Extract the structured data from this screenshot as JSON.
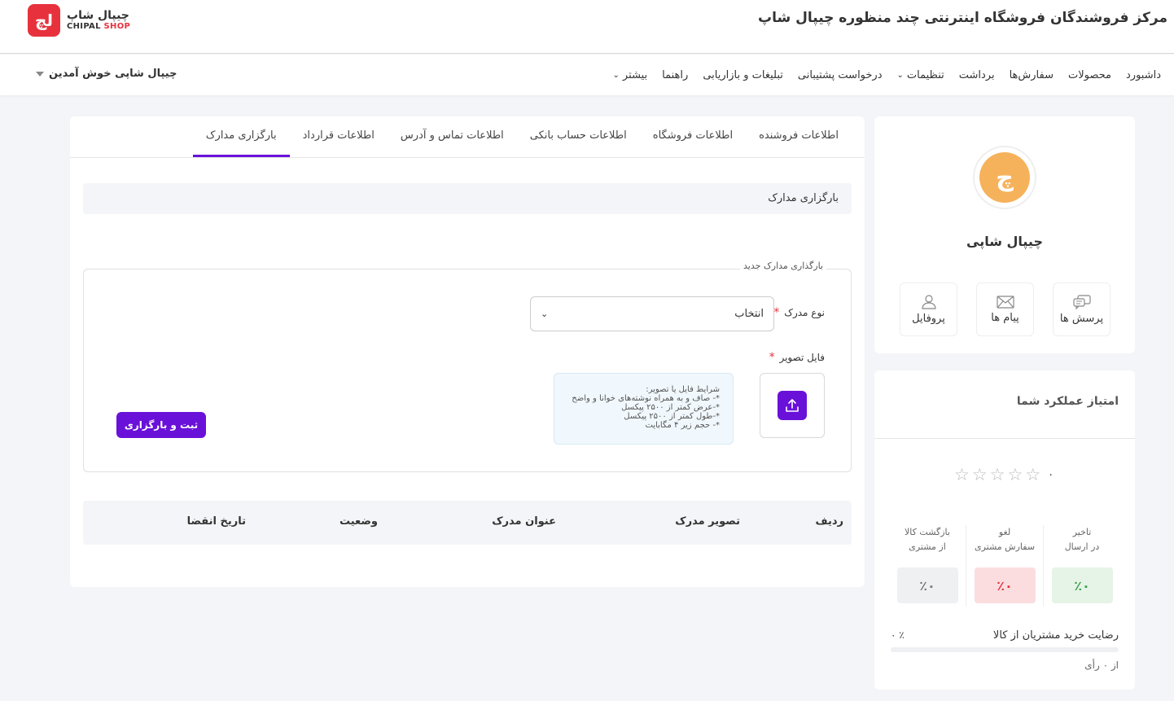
{
  "header": {
    "site_title": "مرکز فروشندگان فروشگاه اینترنتی چند منظوره چیپال شاپ",
    "logo_mark": "لچ",
    "logo_fa": "چیپال شاپ",
    "logo_en_prefix": "CHIPAL ",
    "logo_en_suffix": "SHOP"
  },
  "nav": {
    "items": [
      {
        "label": "داشبورد"
      },
      {
        "label": "محصولات"
      },
      {
        "label": "سفارش‌ها"
      },
      {
        "label": "برداشت"
      },
      {
        "label": "تنظیمات"
      },
      {
        "label": "درخواست پشتیبانی"
      },
      {
        "label": "تبلیغات و بازاریابی"
      },
      {
        "label": "راهنما"
      },
      {
        "label": "بیشتر"
      }
    ],
    "user_welcome": "چیپال شاپی خوش آمدین"
  },
  "tabs": [
    {
      "label": "اطلاعات فروشنده"
    },
    {
      "label": "اطلاعات فروشگاه"
    },
    {
      "label": "اطلاعات حساب بانکی"
    },
    {
      "label": "اطلاعات تماس و آدرس"
    },
    {
      "label": "اطلاعات قرارداد"
    },
    {
      "label": "بارگزاری مدارک"
    }
  ],
  "section_title": "بارگزاری مدارک",
  "form": {
    "legend": "بارگذاری مدارک جدید",
    "doc_type_label": "نوع مدرک",
    "doc_type_value": "انتخاب",
    "file_label": "فایل تصویر",
    "conditions": [
      "شرایط فایل یا تصویر:",
      "*- صاف و به همراه نوشته‌های خوانا و واضح",
      "*-عرض کمتر از ۲۵۰۰ پیکسل",
      "*-طول کمتر از ۲۵۰۰ پیکسل",
      "*- حجم زیر ۴ مگابایت"
    ],
    "submit_label": "ثبت و بارگزاری"
  },
  "table": {
    "headers": [
      "ردیف",
      "تصویر مدرک",
      "عنوان مدرک",
      "وضعیت",
      "تاریخ انقضا"
    ]
  },
  "profile": {
    "avatar_letter": "چ",
    "shop_name": "چیپال شاپی",
    "quick": [
      {
        "label": "پرسش ها",
        "icon": "chat-bubbles-icon"
      },
      {
        "label": "پیام ها",
        "icon": "envelope-icon"
      },
      {
        "label": "پروفایل",
        "icon": "user-icon"
      }
    ]
  },
  "performance": {
    "title": "امتیاز عملکرد شما",
    "rating": "۰",
    "stars_filled": 0,
    "stars_total": 5,
    "metrics": [
      {
        "label_line1": "تاخیر",
        "label_line2": "در ارسال",
        "value": "٪۰",
        "color": "#3a9b4a"
      },
      {
        "label_line1": "لغو",
        "label_line2": "سفارش مشتری",
        "value": "٪۰",
        "color": "#e7323d"
      },
      {
        "label_line1": "بازگشت کالا",
        "label_line2": "از مشتری",
        "value": "٪۰",
        "color": "#777777"
      }
    ],
    "satisfaction_label": "رضایت خرید مشتریان از کالا",
    "satisfaction_value": "٪ ۰",
    "satisfaction_fraction": 0,
    "votes": "از ۰ رأی"
  },
  "colors": {
    "brand_red": "#e7323d",
    "accent_purple": "#6a11d9",
    "avatar_orange": "#f6b25b"
  }
}
